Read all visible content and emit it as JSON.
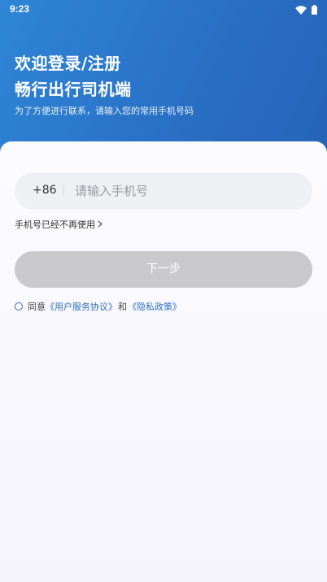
{
  "status_bar": {
    "time": "9:23",
    "icons": [
      "wifi-icon",
      "battery-icon"
    ]
  },
  "header": {
    "title_line1": "欢迎登录/注册",
    "title_line2": "畅行出行司机端",
    "subtitle": "为了方便进行联系，请输入您的常用手机号码"
  },
  "form": {
    "country_code": "+86",
    "phone_placeholder": "请输入手机号",
    "phone_value": "",
    "no_longer_used": "手机号已经不再使用",
    "next_label": "下一步"
  },
  "agreement": {
    "prefix": "同意",
    "user_agreement": "《用户服务协议》",
    "and": "和",
    "privacy_policy": "《隐私政策》"
  },
  "colors": {
    "header_gradient_start": "#2f86d6",
    "header_gradient_end": "#2563b8",
    "link": "#2d6fc1",
    "button_disabled": "#c9c9cb"
  }
}
